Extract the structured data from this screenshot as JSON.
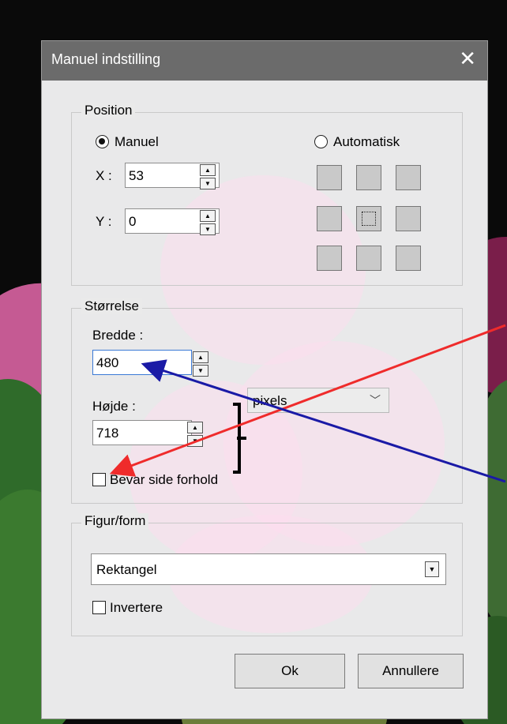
{
  "dialog": {
    "title": "Manuel indstilling",
    "close_glyph": "✕"
  },
  "position": {
    "legend": "Position",
    "manual_label": "Manuel",
    "auto_label": "Automatisk",
    "manual_selected": true,
    "x_label": "X :",
    "x_value": "53",
    "y_label": "Y :",
    "y_value": "0"
  },
  "size": {
    "legend": "Størrelse",
    "width_label": "Bredde :",
    "width_value": "480",
    "height_label": "Højde :",
    "height_value": "718",
    "unit": "pixels",
    "keep_ratio_label": "Bevar side forhold",
    "keep_ratio_checked": false
  },
  "shape": {
    "legend": "Figur/form",
    "value": "Rektangel",
    "invert_label": "Invertere",
    "invert_checked": false
  },
  "buttons": {
    "ok": "Ok",
    "cancel": "Annullere"
  },
  "annotation_colors": {
    "red_arrow": "#ef2b2b",
    "blue_arrow": "#1a1aa6"
  }
}
